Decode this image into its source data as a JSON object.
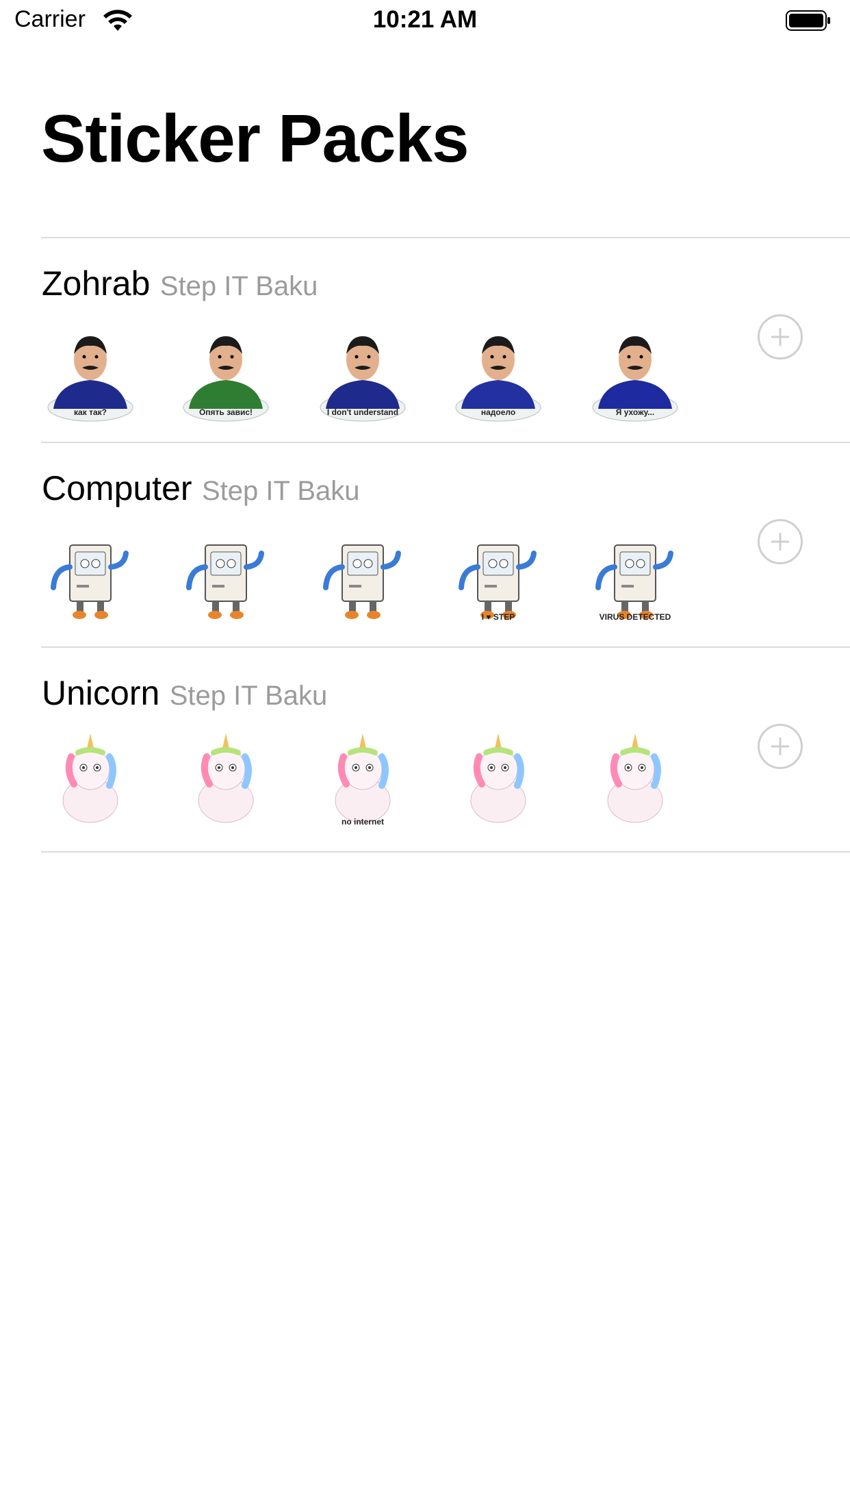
{
  "status_bar": {
    "carrier": "Carrier",
    "time": "10:21 AM"
  },
  "title": "Sticker Packs",
  "packs": [
    {
      "name": "Zohrab",
      "publisher": "Step IT Baku",
      "stickers": [
        {
          "caption": "как так?",
          "shirt": "#1e2a8c"
        },
        {
          "caption": "Опять завис!",
          "shirt": "#2e7d32"
        },
        {
          "caption": "I don't understand",
          "shirt": "#1e2a8c"
        },
        {
          "caption": "надоело",
          "shirt": "#2230a0"
        },
        {
          "caption": "Я ухожу...",
          "shirt": "#1e2aa0"
        }
      ]
    },
    {
      "name": "Computer",
      "publisher": "Step IT Baku",
      "stickers": [
        {
          "caption": ""
        },
        {
          "caption": ""
        },
        {
          "caption": ""
        },
        {
          "caption": "I ♥ STEP"
        },
        {
          "caption": "VIRUS DETECTED"
        }
      ]
    },
    {
      "name": "Unicorn",
      "publisher": "Step IT Baku",
      "stickers": [
        {
          "caption": ""
        },
        {
          "caption": ""
        },
        {
          "caption": "no internet"
        },
        {
          "caption": ""
        },
        {
          "caption": ""
        }
      ]
    }
  ],
  "colors": {
    "accent_gray": "#9b9b9b",
    "divider": "#dcdcdc",
    "add_button": "#cfcfcf"
  }
}
